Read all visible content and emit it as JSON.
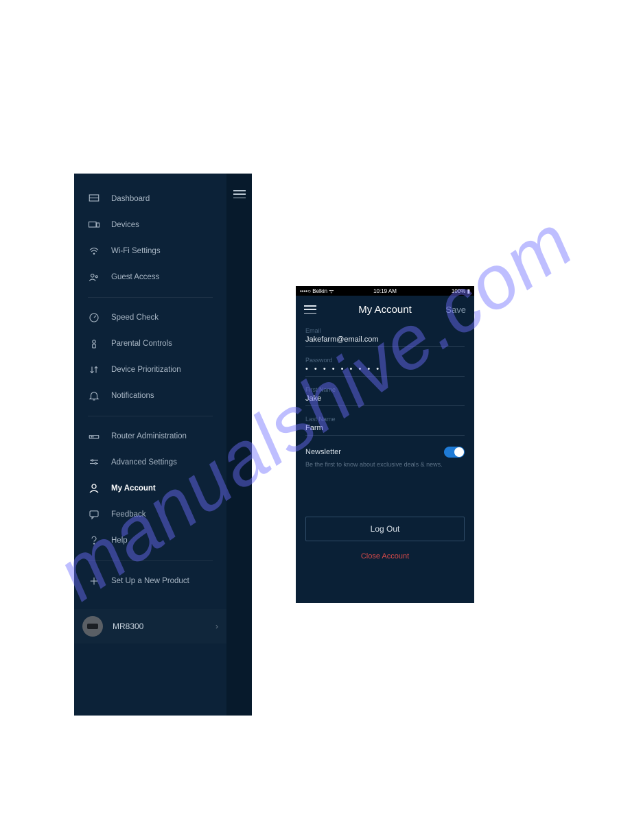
{
  "watermark": "manualshive.com",
  "sidebar": {
    "items": [
      {
        "icon": "dashboard-icon",
        "label": "Dashboard"
      },
      {
        "icon": "devices-icon",
        "label": "Devices"
      },
      {
        "icon": "wifi-icon",
        "label": "Wi-Fi Settings"
      },
      {
        "icon": "guest-icon",
        "label": "Guest Access"
      }
    ],
    "items2": [
      {
        "icon": "speed-icon",
        "label": "Speed Check"
      },
      {
        "icon": "parental-icon",
        "label": "Parental Controls"
      },
      {
        "icon": "priority-icon",
        "label": "Device Prioritization"
      },
      {
        "icon": "bell-icon",
        "label": "Notifications"
      }
    ],
    "items3": [
      {
        "icon": "router-icon",
        "label": "Router Administration"
      },
      {
        "icon": "sliders-icon",
        "label": "Advanced Settings"
      },
      {
        "icon": "person-icon",
        "label": "My Account",
        "active": true
      },
      {
        "icon": "chat-icon",
        "label": "Feedback"
      },
      {
        "icon": "help-icon",
        "label": "Help"
      }
    ],
    "items4": [
      {
        "icon": "plus-icon",
        "label": "Set Up a New Product"
      }
    ],
    "device": {
      "label": "MR8300",
      "chev": "›"
    }
  },
  "statusbar": {
    "carrier": "••••○ Belkin ᯤ",
    "time": "10:19 AM",
    "battery": "100% ▮"
  },
  "navbar": {
    "title": "My Account",
    "save": "Save"
  },
  "form": {
    "email_label": "Email",
    "email_value": "Jakefarm@email.com",
    "password_label": "Password",
    "password_value": "• • • • • • • • •",
    "first_label": "First Name",
    "first_value": "Jake",
    "last_label": "Last Name",
    "last_value": "Farm"
  },
  "newsletter": {
    "label": "Newsletter",
    "description": "Be the first to know about exclusive deals & news."
  },
  "buttons": {
    "logout": "Log Out",
    "close": "Close Account"
  }
}
